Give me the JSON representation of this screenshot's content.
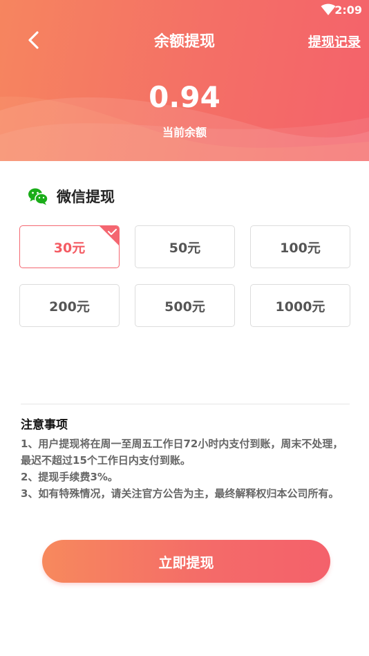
{
  "status_bar": {
    "time": "2:09",
    "wifi_icon": "wifi-icon"
  },
  "nav": {
    "back_icon": "chevron-left-icon",
    "title": "余额提现",
    "record_link": "提现记录"
  },
  "balance": {
    "amount": "0.94",
    "label": "当前余额"
  },
  "method": {
    "icon": "wechat-icon",
    "label": "微信提现"
  },
  "amounts": [
    {
      "label": "30元",
      "selected": true
    },
    {
      "label": "50元",
      "selected": false
    },
    {
      "label": "100元",
      "selected": false
    },
    {
      "label": "200元",
      "selected": false
    },
    {
      "label": "500元",
      "selected": false
    },
    {
      "label": "1000元",
      "selected": false
    }
  ],
  "notes": {
    "title": "注意事项",
    "items": [
      "1、用户提现将在周一至周五工作日72小时内支付到账，周末不处理，最迟不超过15个工作日内支付到账。",
      "2、提现手续费3%。",
      "3、如有特殊情况，请关注官方公告为主，最终解释权归本公司所有。"
    ]
  },
  "submit": {
    "label": "立即提现"
  },
  "colors": {
    "accent": "#f46670",
    "header_start": "#f6855f",
    "header_end": "#f4626b",
    "wechat_green": "#1aad19"
  }
}
